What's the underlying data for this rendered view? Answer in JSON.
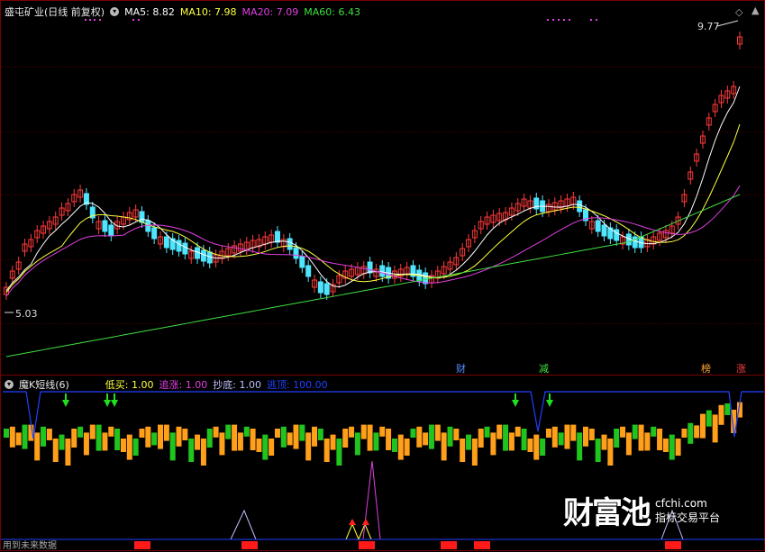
{
  "stock": {
    "title": "盛屯矿业(日线 前复权)",
    "ma5_label": "MA5:",
    "ma5_value": "8.82",
    "ma10_label": "MA10:",
    "ma10_value": "7.98",
    "ma20_label": "MA20:",
    "ma20_value": "7.09",
    "ma60_label": "MA60:",
    "ma60_value": "6.43",
    "high_marker": "9.77",
    "low_marker": "5.03",
    "colors": {
      "up": "#ff3a3a",
      "down": "#4fe5ff",
      "ma5": "#ffffff",
      "ma10": "#ffff40",
      "ma20": "#e040e0",
      "ma60": "#40e040"
    }
  },
  "event_tags": [
    {
      "label": "财",
      "color": "#4f8fff"
    },
    {
      "label": "减",
      "color": "#40e040"
    },
    {
      "label": "榜",
      "color": "#ffaa30"
    },
    {
      "label": "涨",
      "color": "#ff4040"
    }
  ],
  "indicator": {
    "title": "魔K短线(6)",
    "low_buy_label": "低买:",
    "low_buy_value": "1.00",
    "chase_label": "追涨:",
    "chase_value": "1.00",
    "bottom_label": "抄底:",
    "bottom_value": "1.00",
    "top_label": "逃顶:",
    "top_value": "100.00",
    "colors": {
      "low_buy": "#ffff40",
      "chase": "#e040e0",
      "bottom": "#c0c0ff",
      "top": "#2040ff"
    }
  },
  "footer": {
    "hint": "用到未来数据"
  },
  "watermark": {
    "brand": "财富池",
    "domain": "cfchi.com",
    "slogan": "指标交易平台"
  }
}
